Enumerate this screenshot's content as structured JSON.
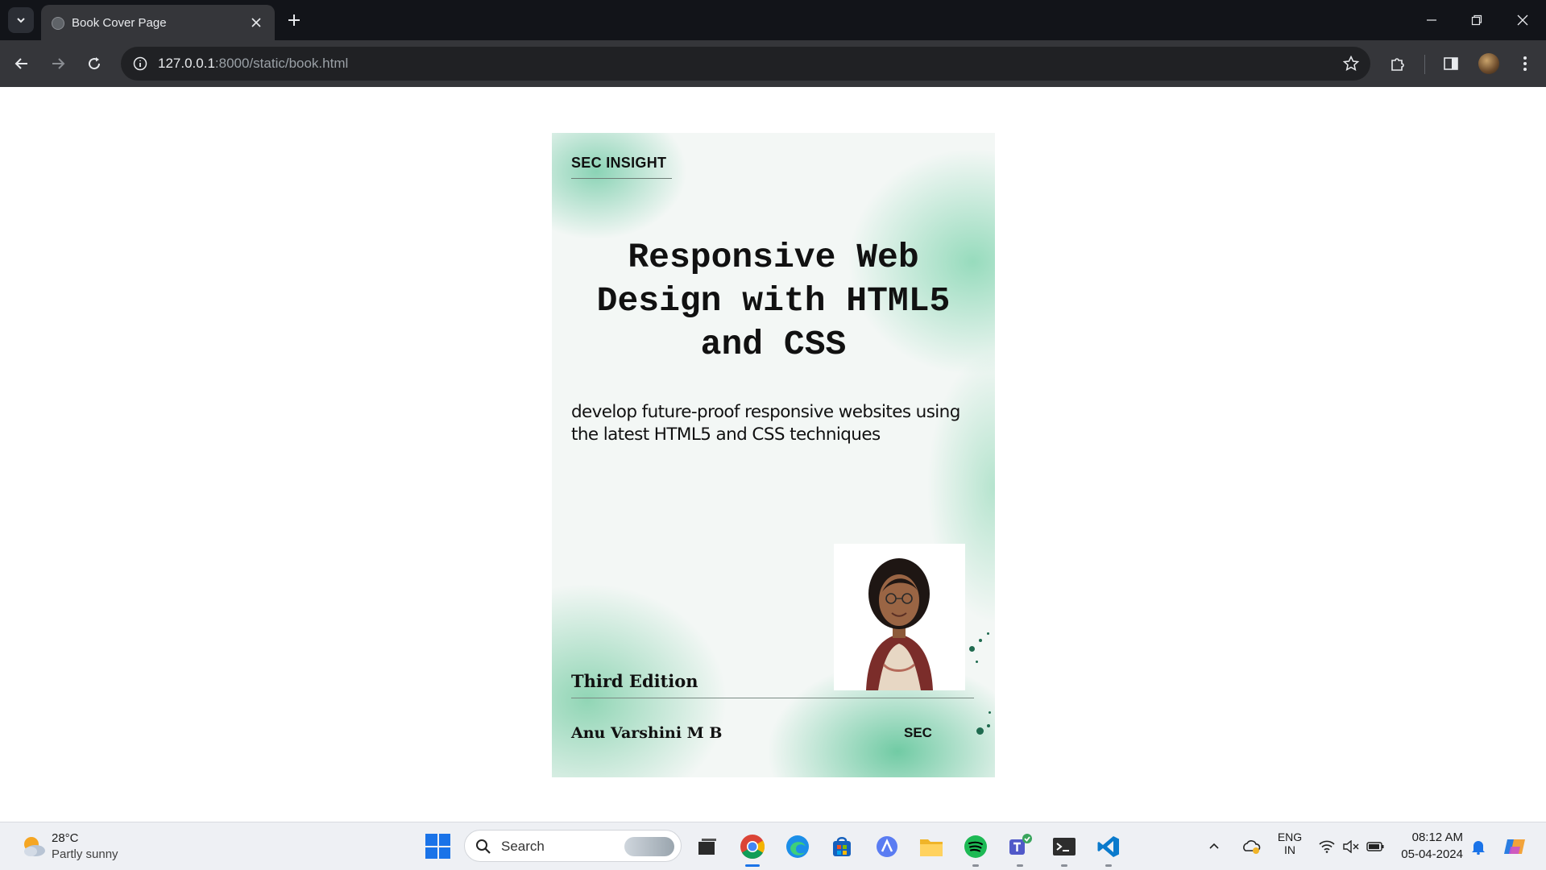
{
  "browser": {
    "tab_title": "Book Cover Page",
    "url_host": "127.0.0.1",
    "url_path": ":8000/static/book.html"
  },
  "book": {
    "publisher_top": "SEC INSIGHT",
    "title_line1": "Responsive Web",
    "title_line2": "Design with HTML5",
    "title_line3": "and CSS",
    "subtitle": "develop future-proof responsive websites using the latest HTML5 and CSS techniques",
    "edition": "Third Edition",
    "author": "Anu Varshini M B",
    "publisher_bottom": "SEC"
  },
  "taskbar": {
    "weather_temp": "28°C",
    "weather_desc": "Partly sunny",
    "search_label": "Search",
    "lang_line1": "ENG",
    "lang_line2": "IN",
    "time": "08:12 AM",
    "date": "05-04-2024"
  },
  "colors": {
    "titlebar": "#121419",
    "toolbar": "#35363a",
    "cover_accent": "#7fd1ad",
    "taskbar": "#eef0f4"
  }
}
